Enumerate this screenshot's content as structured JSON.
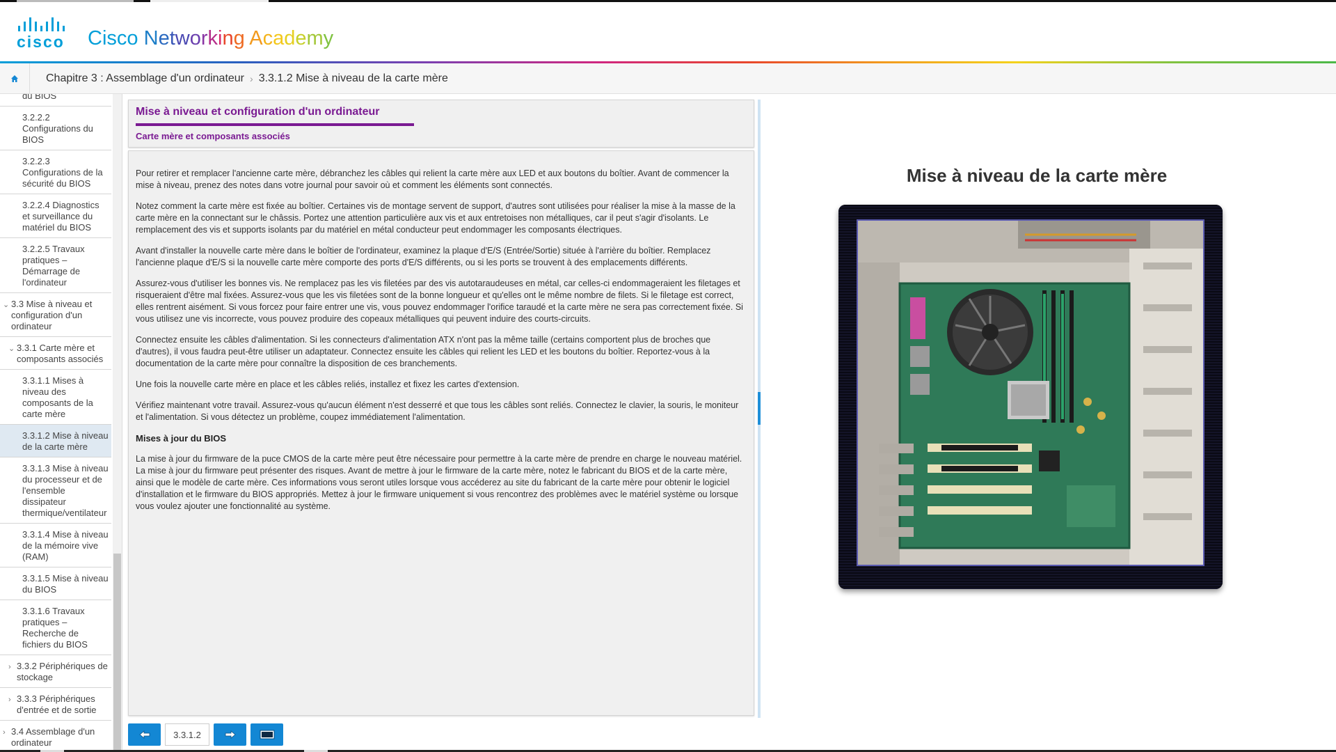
{
  "header": {
    "logo_text": "cisco",
    "brand_letters": [
      {
        "ch": "C",
        "color": "#049fd9"
      },
      {
        "ch": "i",
        "color": "#049fd9"
      },
      {
        "ch": "s",
        "color": "#049fd9"
      },
      {
        "ch": "c",
        "color": "#049fd9"
      },
      {
        "ch": "o",
        "color": "#049fd9"
      },
      {
        "ch": " ",
        "color": "#049fd9"
      },
      {
        "ch": "N",
        "color": "#1e7fc8"
      },
      {
        "ch": "e",
        "color": "#2b6ac0"
      },
      {
        "ch": "t",
        "color": "#3a58b8"
      },
      {
        "ch": "w",
        "color": "#4b49b2"
      },
      {
        "ch": "o",
        "color": "#6a3fae"
      },
      {
        "ch": "r",
        "color": "#8a35a4"
      },
      {
        "ch": "k",
        "color": "#b52d8a"
      },
      {
        "ch": "i",
        "color": "#d82a6c"
      },
      {
        "ch": "n",
        "color": "#e8462b"
      },
      {
        "ch": "g",
        "color": "#ee6a22"
      },
      {
        "ch": " ",
        "color": "#f29a1e"
      },
      {
        "ch": "A",
        "color": "#f29a1e"
      },
      {
        "ch": "c",
        "color": "#f4b41c"
      },
      {
        "ch": "a",
        "color": "#f4c81c"
      },
      {
        "ch": "d",
        "color": "#e6d020"
      },
      {
        "ch": "e",
        "color": "#c7d02c"
      },
      {
        "ch": "m",
        "color": "#a4c83a"
      },
      {
        "ch": "y",
        "color": "#7fc241"
      }
    ]
  },
  "breadcrumb": {
    "home_icon": "home-icon",
    "chapter": "Chapitre 3 : Assemblage d'un ordinateur",
    "separator": "›",
    "current": "3.3.1.2 Mise à niveau de la carte mère"
  },
  "sidebar": {
    "items": [
      {
        "label": "du BIOS",
        "level": 3,
        "chevron": "",
        "active": false
      },
      {
        "label": "3.2.2.2 Configurations du BIOS",
        "level": 3,
        "chevron": "",
        "active": false
      },
      {
        "label": "3.2.2.3 Configurations de la sécurité du BIOS",
        "level": 3,
        "chevron": "",
        "active": false
      },
      {
        "label": "3.2.2.4 Diagnostics et surveillance du matériel du BIOS",
        "level": 3,
        "chevron": "",
        "active": false
      },
      {
        "label": "3.2.2.5 Travaux pratiques – Démarrage de l'ordinateur",
        "level": 3,
        "chevron": "",
        "active": false
      },
      {
        "label": "3.3 Mise à niveau et configuration d'un ordinateur",
        "level": 1,
        "chevron": "⌄",
        "active": false
      },
      {
        "label": "3.3.1 Carte mère et composants associés",
        "level": 2,
        "chevron": "⌄",
        "active": false
      },
      {
        "label": "3.3.1.1 Mises à niveau des composants de la carte mère",
        "level": 3,
        "chevron": "",
        "active": false
      },
      {
        "label": "3.3.1.2 Mise à niveau de la carte mère",
        "level": 3,
        "chevron": "",
        "active": true
      },
      {
        "label": "3.3.1.3 Mise à niveau du processeur et de l'ensemble dissipateur thermique/ventilateur",
        "level": 3,
        "chevron": "",
        "active": false
      },
      {
        "label": "3.3.1.4 Mise à niveau de la mémoire vive (RAM)",
        "level": 3,
        "chevron": "",
        "active": false
      },
      {
        "label": "3.3.1.5 Mise à niveau du BIOS",
        "level": 3,
        "chevron": "",
        "active": false
      },
      {
        "label": "3.3.1.6 Travaux pratiques – Recherche de fichiers du BIOS",
        "level": 3,
        "chevron": "",
        "active": false
      },
      {
        "label": "3.3.2 Périphériques de stockage",
        "level": 2,
        "chevron": "›",
        "active": false
      },
      {
        "label": "3.3.3 Périphériques d'entrée et de sortie",
        "level": 2,
        "chevron": "›",
        "active": false
      },
      {
        "label": "3.4 Assemblage d'un ordinateur",
        "level": 1,
        "chevron": "›",
        "active": false
      }
    ]
  },
  "panel": {
    "title": "Mise à niveau et configuration d'un ordinateur",
    "subtitle": "Carte mère et composants associés",
    "paragraphs": [
      "Pour retirer et remplacer l'ancienne carte mère, débranchez les câbles qui relient la carte mère aux LED et aux boutons du boîtier. Avant de commencer la mise à niveau, prenez des notes dans votre journal pour savoir où et comment les éléments sont connectés.",
      "Notez comment la carte mère est fixée au boîtier. Certaines vis de montage servent de support, d'autres sont utilisées pour réaliser la mise à la masse de la carte mère en la connectant sur le châssis. Portez une attention particulière aux vis et aux entretoises non métalliques, car il peut s'agir d'isolants. Le remplacement des vis et supports isolants par du matériel en métal conducteur peut endommager les composants électriques.",
      "Avant d'installer la nouvelle carte mère dans le boîtier de l'ordinateur, examinez la plaque d'E/S (Entrée/Sortie) située à l'arrière du boîtier. Remplacez l'ancienne plaque d'E/S si la nouvelle carte mère comporte des ports d'E/S différents, ou si les ports se trouvent à des emplacements différents.",
      "Assurez-vous d'utiliser les bonnes vis. Ne remplacez pas les vis filetées par des vis autotaraudeuses en métal, car celles-ci endommageraient les filetages et risqueraient d'être mal fixées. Assurez-vous que les vis filetées sont de la bonne longueur et qu'elles ont le même nombre de filets. Si le filetage est correct, elles rentrent aisément. Si vous forcez pour faire entrer une vis, vous pouvez endommager l'orifice taraudé et la carte mère ne sera pas correctement fixée. Si vous utilisez une vis incorrecte, vous pouvez produire des copeaux métalliques qui peuvent induire des courts-circuits.",
      "Connectez ensuite les câbles d'alimentation. Si les connecteurs d'alimentation ATX n'ont pas la même taille (certains comportent plus de broches que d'autres), il vous faudra peut-être utiliser un adaptateur. Connectez ensuite les câbles qui relient les LED et les boutons du boîtier. Reportez-vous à la documentation de la carte mère pour connaître la disposition de ces branchements.",
      "Une fois la nouvelle carte mère en place et les câbles reliés, installez et fixez les cartes d'extension.",
      "Vérifiez maintenant votre travail. Assurez-vous qu'aucun élément n'est desserré et que tous les câbles sont reliés. Connectez le clavier, la souris, le moniteur et l'alimentation. Si vous détectez un problème, coupez immédiatement l'alimentation."
    ],
    "bios_heading": "Mises à jour du BIOS",
    "bios_paragraph": "La mise à jour du firmware de la puce CMOS de la carte mère peut être nécessaire pour permettre à la carte mère de prendre en charge le nouveau matériel. La mise à jour du firmware peut présenter des risques. Avant de mettre à jour le firmware de la carte mère, notez le fabricant du BIOS et de la carte mère, ainsi que le modèle de carte mère. Ces informations vous seront utiles lorsque vous accéderez au site du fabricant de la carte mère pour obtenir le logiciel d'installation et le firmware du BIOS appropriés. Mettez à jour le firmware uniquement si vous rencontrez des problèmes avec le matériel système ou lorsque vous voulez ajouter une fonctionnalité au système."
  },
  "nav": {
    "prev_icon": "arrow-left-icon",
    "page": "3.3.1.2",
    "next_icon": "arrow-right-icon",
    "fullscreen_icon": "fullscreen-icon"
  },
  "media": {
    "title": "Mise à niveau de la carte mère",
    "image_icon": "motherboard-image"
  },
  "colors": {
    "accent": "#1387d4",
    "purple": "#7a1a92"
  }
}
